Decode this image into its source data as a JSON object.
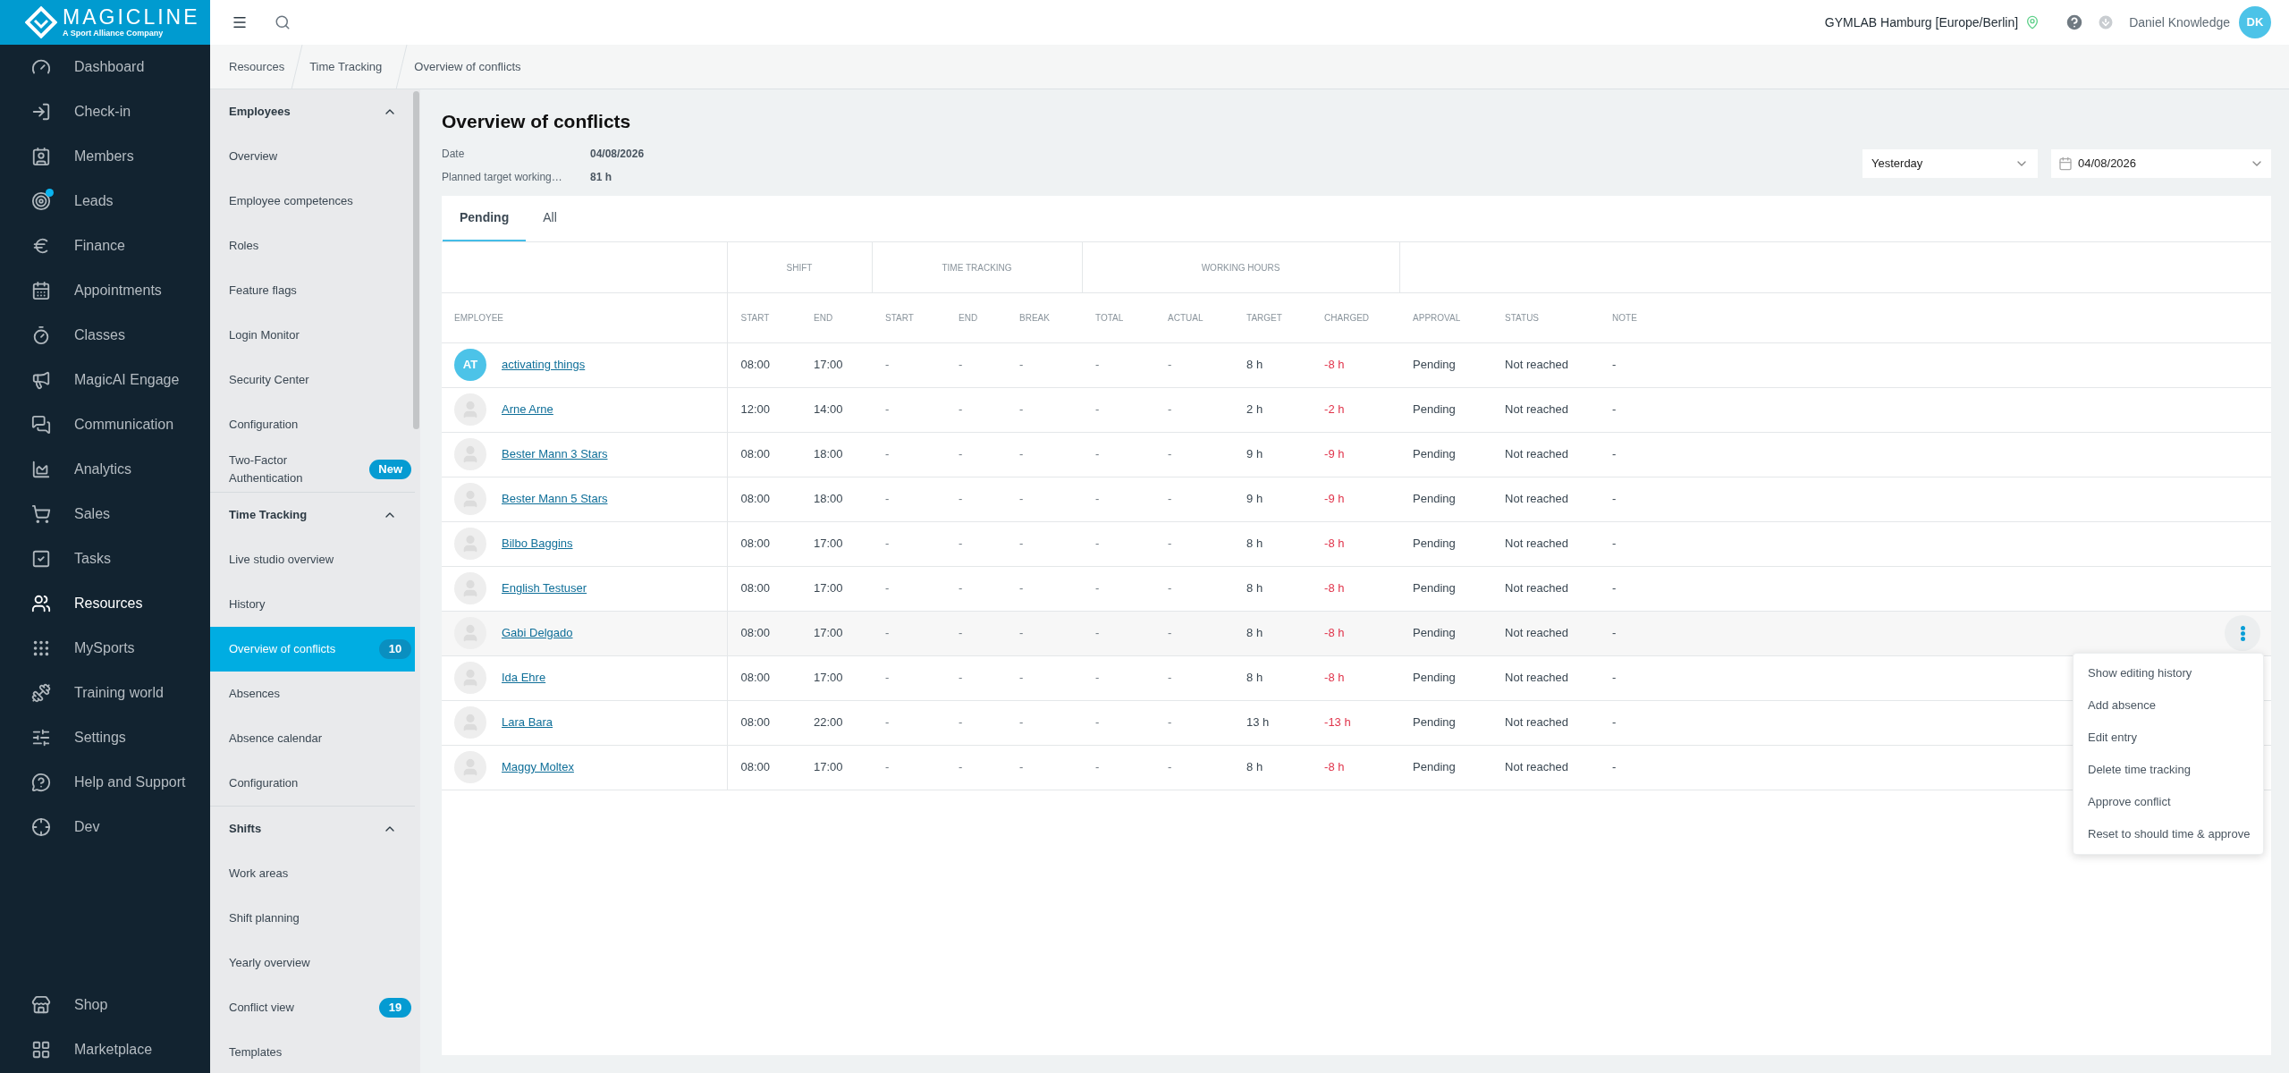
{
  "brand": {
    "name": "MAGICLINE",
    "tagline": "A Sport Alliance Company"
  },
  "sidebar": {
    "items": [
      {
        "label": "Dashboard",
        "selected": false,
        "dot": false
      },
      {
        "label": "Check-in",
        "selected": false,
        "dot": false
      },
      {
        "label": "Members",
        "selected": false,
        "dot": false
      },
      {
        "label": "Leads",
        "selected": false,
        "dot": true
      },
      {
        "label": "Finance",
        "selected": false,
        "dot": false
      },
      {
        "label": "Appointments",
        "selected": false,
        "dot": false
      },
      {
        "label": "Classes",
        "selected": false,
        "dot": false
      },
      {
        "label": "MagicAI Engage",
        "selected": false,
        "dot": false
      },
      {
        "label": "Communication",
        "selected": false,
        "dot": false
      },
      {
        "label": "Analytics",
        "selected": false,
        "dot": false
      },
      {
        "label": "Sales",
        "selected": false,
        "dot": false
      },
      {
        "label": "Tasks",
        "selected": false,
        "dot": false
      },
      {
        "label": "Resources",
        "selected": true,
        "dot": false
      },
      {
        "label": "MySports",
        "selected": false,
        "dot": false
      },
      {
        "label": "Training world",
        "selected": false,
        "dot": false
      },
      {
        "label": "Settings",
        "selected": false,
        "dot": false
      },
      {
        "label": "Help and Support",
        "selected": false,
        "dot": false
      },
      {
        "label": "Dev",
        "selected": false,
        "dot": false
      }
    ],
    "bottom_items": [
      {
        "label": "Shop",
        "selected": false
      },
      {
        "label": "Marketplace",
        "selected": false
      }
    ]
  },
  "header": {
    "location": "GYMLAB Hamburg [Europe/Berlin]",
    "user": "Daniel Knowledge",
    "user_initials": "DK"
  },
  "breadcrumbs": [
    "Resources",
    "Time Tracking",
    "Overview of conflicts"
  ],
  "submenu": [
    {
      "title": "Employees",
      "expanded": true,
      "items": [
        {
          "label": "Overview",
          "selected": false
        },
        {
          "label": "Employee competences",
          "selected": false
        },
        {
          "label": "Roles",
          "selected": false
        },
        {
          "label": "Feature flags",
          "selected": false
        },
        {
          "label": "Login Monitor",
          "selected": false
        },
        {
          "label": "Security Center",
          "selected": false
        },
        {
          "label": "Configuration",
          "selected": false
        },
        {
          "label": "Two-Factor Authentication",
          "selected": false,
          "badge": "New"
        }
      ]
    },
    {
      "title": "Time Tracking",
      "expanded": true,
      "items": [
        {
          "label": "Live studio overview",
          "selected": false
        },
        {
          "label": "History",
          "selected": false
        },
        {
          "label": "Overview of conflicts",
          "selected": true,
          "badge": "10"
        },
        {
          "label": "Absences",
          "selected": false
        },
        {
          "label": "Absence calendar",
          "selected": false
        },
        {
          "label": "Configuration",
          "selected": false
        }
      ]
    },
    {
      "title": "Shifts",
      "expanded": true,
      "items": [
        {
          "label": "Work areas",
          "selected": false
        },
        {
          "label": "Shift planning",
          "selected": false
        },
        {
          "label": "Yearly overview",
          "selected": false
        },
        {
          "label": "Conflict view",
          "selected": false,
          "badge": "19"
        },
        {
          "label": "Templates",
          "selected": false
        }
      ]
    }
  ],
  "page": {
    "title": "Overview of conflicts",
    "info": [
      {
        "label": "Date",
        "value": "04/08/2026"
      },
      {
        "label": "Planned target working…",
        "value": "81 h"
      }
    ],
    "period_select": {
      "value": "Yesterday"
    },
    "date_field": {
      "value": "04/08/2026"
    }
  },
  "tabs": [
    {
      "label": "Pending",
      "selected": true
    },
    {
      "label": "All",
      "selected": false
    }
  ],
  "table": {
    "first_column": "EMPLOYEE",
    "column_groups": [
      {
        "label": "SHIFT",
        "columns": [
          "START",
          "END"
        ]
      },
      {
        "label": "TIME TRACKING",
        "columns": [
          "START",
          "END",
          "BREAK"
        ]
      },
      {
        "label": "WORKING HOURS",
        "columns": [
          "TOTAL",
          "ACTUAL",
          "TARGET",
          "CHARGED"
        ]
      }
    ],
    "trailing_columns": [
      "APPROVAL",
      "STATUS",
      "NOTE"
    ],
    "rows": [
      {
        "employee": "activating things",
        "avatar": "AT",
        "hovered": false,
        "cells": [
          "08:00",
          "17:00",
          "-",
          "-",
          "-",
          "-",
          "-",
          "8 h",
          "-8 h",
          "Pending",
          "Not reached",
          "-"
        ]
      },
      {
        "employee": "Arne Arne",
        "hovered": false,
        "cells": [
          "12:00",
          "14:00",
          "-",
          "-",
          "-",
          "-",
          "-",
          "2 h",
          "-2 h",
          "Pending",
          "Not reached",
          "-"
        ]
      },
      {
        "employee": "Bester Mann 3 Stars",
        "hovered": false,
        "cells": [
          "08:00",
          "18:00",
          "-",
          "-",
          "-",
          "-",
          "-",
          "9 h",
          "-9 h",
          "Pending",
          "Not reached",
          "-"
        ]
      },
      {
        "employee": "Bester Mann 5 Stars",
        "hovered": false,
        "cells": [
          "08:00",
          "18:00",
          "-",
          "-",
          "-",
          "-",
          "-",
          "9 h",
          "-9 h",
          "Pending",
          "Not reached",
          "-"
        ]
      },
      {
        "employee": "Bilbo Baggins",
        "hovered": false,
        "cells": [
          "08:00",
          "17:00",
          "-",
          "-",
          "-",
          "-",
          "-",
          "8 h",
          "-8 h",
          "Pending",
          "Not reached",
          "-"
        ]
      },
      {
        "employee": "English Testuser",
        "hovered": false,
        "cells": [
          "08:00",
          "17:00",
          "-",
          "-",
          "-",
          "-",
          "-",
          "8 h",
          "-8 h",
          "Pending",
          "Not reached",
          "-"
        ]
      },
      {
        "employee": "Gabi Delgado",
        "hovered": true,
        "cells": [
          "08:00",
          "17:00",
          "-",
          "-",
          "-",
          "-",
          "-",
          "8 h",
          "-8 h",
          "Pending",
          "Not reached",
          "-"
        ]
      },
      {
        "employee": "Ida Ehre",
        "hovered": false,
        "cells": [
          "08:00",
          "17:00",
          "-",
          "-",
          "-",
          "-",
          "-",
          "8 h",
          "-8 h",
          "Pending",
          "Not reached",
          "-"
        ]
      },
      {
        "employee": "Lara Bara",
        "hovered": false,
        "cells": [
          "08:00",
          "22:00",
          "-",
          "-",
          "-",
          "-",
          "-",
          "13 h",
          "-13 h",
          "Pending",
          "Not reached",
          "-"
        ]
      },
      {
        "employee": "Maggy Moltex",
        "hovered": false,
        "cells": [
          "08:00",
          "17:00",
          "-",
          "-",
          "-",
          "-",
          "-",
          "8 h",
          "-8 h",
          "Pending",
          "Not reached",
          "-"
        ]
      }
    ]
  },
  "row_menu": [
    "Show editing history",
    "Add absence",
    "Edit entry",
    "Delete time tracking",
    "Approve conflict",
    "Reset to should time & approve"
  ]
}
